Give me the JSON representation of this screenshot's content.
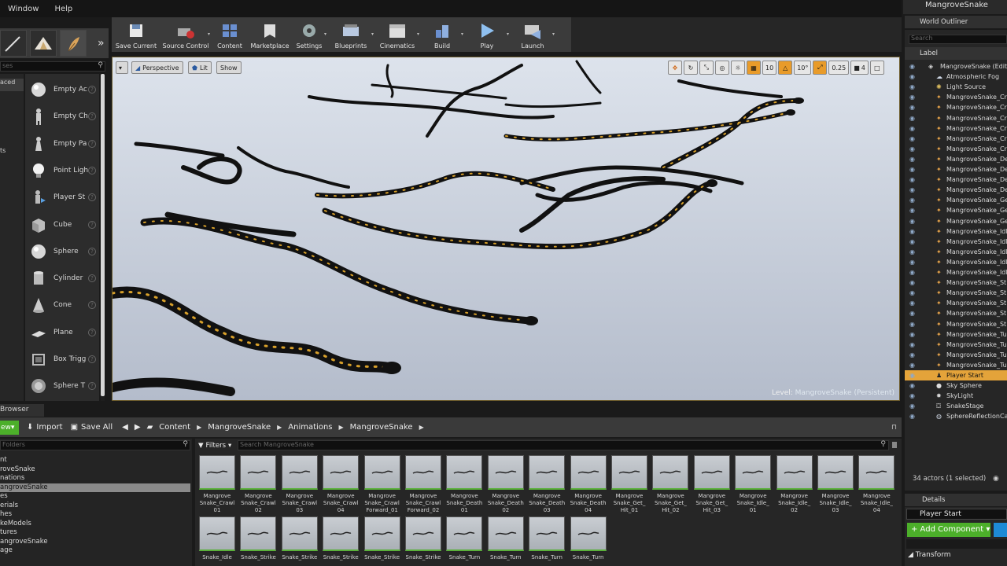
{
  "menu": {
    "items": [
      "Window",
      "Help"
    ]
  },
  "window": {
    "tab_title": "MangroveSnake"
  },
  "modes": {
    "search_placeholder": "ses",
    "categories": [
      "aced",
      "ts"
    ],
    "items": [
      {
        "label": "Empty Ac",
        "icon": "sphere-icon"
      },
      {
        "label": "Empty Ch",
        "icon": "mannequin-icon"
      },
      {
        "label": "Empty Pa",
        "icon": "pawn-icon"
      },
      {
        "label": "Point Ligh",
        "icon": "light-bulb-icon"
      },
      {
        "label": "Player St",
        "icon": "player-start-icon"
      },
      {
        "label": "Cube",
        "icon": "cube-icon"
      },
      {
        "label": "Sphere",
        "icon": "sphere-icon"
      },
      {
        "label": "Cylinder",
        "icon": "cylinder-icon"
      },
      {
        "label": "Cone",
        "icon": "cone-icon"
      },
      {
        "label": "Plane",
        "icon": "plane-icon"
      },
      {
        "label": "Box Trigg",
        "icon": "box-trigger-icon"
      },
      {
        "label": "Sphere T",
        "icon": "sphere-trigger-icon"
      }
    ]
  },
  "toolbar": {
    "buttons": [
      {
        "label": "Save Current",
        "icon": "save-icon",
        "dropdown": false
      },
      {
        "label": "Source Control",
        "icon": "source-control-icon",
        "dropdown": true
      },
      {
        "label": "Content",
        "icon": "content-icon",
        "dropdown": false
      },
      {
        "label": "Marketplace",
        "icon": "marketplace-icon",
        "dropdown": false
      },
      {
        "label": "Settings",
        "icon": "settings-icon",
        "dropdown": true
      },
      {
        "label": "Blueprints",
        "icon": "blueprints-icon",
        "dropdown": true
      },
      {
        "label": "Cinematics",
        "icon": "cinematics-icon",
        "dropdown": true
      },
      {
        "label": "Build",
        "icon": "build-icon",
        "dropdown": true
      },
      {
        "label": "Play",
        "icon": "play-icon",
        "dropdown": true
      },
      {
        "label": "Launch",
        "icon": "launch-icon",
        "dropdown": true
      }
    ]
  },
  "viewport": {
    "view_mode": "Perspective",
    "lighting": "Lit",
    "show": "Show",
    "grid_snap": "10",
    "rotation_snap": "10°",
    "scale_snap": "0.25",
    "camera_speed": "4",
    "level_label": "Level:",
    "level_name": "MangroveSnake (Persistent)"
  },
  "content_browser": {
    "tab": "Browser",
    "new_label": "ew",
    "import_label": "Import",
    "save_all_label": "Save All",
    "breadcrumbs": [
      "Content",
      "MangroveSnake",
      "Animations",
      "MangroveSnake"
    ],
    "folder_search_placeholder": "Folders",
    "tree": [
      "nt",
      "roveSnake",
      "nations",
      "angroveSnake",
      "es",
      "erials",
      "hes",
      "keModels",
      "tures",
      "angroveSnake",
      "age"
    ],
    "selected_tree_index": 3,
    "filters_label": "Filters",
    "asset_search_placeholder": "Search MangroveSnake",
    "assets": [
      "Mangrove\nSnake_Crawl\n01",
      "Mangrove\nSnake_Crawl\n02",
      "Mangrove\nSnake_Crawl\n03",
      "Mangrove\nSnake_Crawl\n04",
      "Mangrove\nSnake_Crawl\nForward_01",
      "Mangrove\nSnake_Crawl\nForward_02",
      "Mangrove\nSnake_Death\n01",
      "Mangrove\nSnake_Death\n02",
      "Mangrove\nSnake_Death\n03",
      "Mangrove\nSnake_Death\n04",
      "Mangrove\nSnake_Get_\nHit_01",
      "Mangrove\nSnake_Get_\nHit_02",
      "Mangrove\nSnake_Get_\nHit_03",
      "Mangrove\nSnake_Idle_\n01",
      "Mangrove\nSnake_Idle_\n02",
      "Mangrove\nSnake_Idle_\n03",
      "Mangrove\nSnake_Idle_\n04",
      "Snake_Idle",
      "Snake_Strike",
      "Snake_Strike",
      "Snake_Strike",
      "Snake_Strike",
      "Snake_Strike",
      "Snake_Turn",
      "Snake_Turn",
      "Snake_Turn",
      "Snake_Turn"
    ]
  },
  "outliner": {
    "tab": "World Outliner",
    "search_placeholder": "Search",
    "column_label": "Label",
    "rows": [
      {
        "text": "MangroveSnake (Edito",
        "indent": 0,
        "icon": "world-icon"
      },
      {
        "text": "Atmospheric Fog",
        "indent": 1,
        "icon": "fog-icon"
      },
      {
        "text": "Light Source",
        "indent": 1,
        "icon": "sun-icon"
      },
      {
        "text": "MangroveSnake_Cr",
        "indent": 1,
        "icon": "actor-icon"
      },
      {
        "text": "MangroveSnake_Cr",
        "indent": 1,
        "icon": "actor-icon"
      },
      {
        "text": "MangroveSnake_Cr",
        "indent": 1,
        "icon": "actor-icon"
      },
      {
        "text": "MangroveSnake_Cr",
        "indent": 1,
        "icon": "actor-icon"
      },
      {
        "text": "MangroveSnake_Cr",
        "indent": 1,
        "icon": "actor-icon"
      },
      {
        "text": "MangroveSnake_Cr",
        "indent": 1,
        "icon": "actor-icon"
      },
      {
        "text": "MangroveSnake_De",
        "indent": 1,
        "icon": "actor-icon"
      },
      {
        "text": "MangroveSnake_De",
        "indent": 1,
        "icon": "actor-icon"
      },
      {
        "text": "MangroveSnake_De",
        "indent": 1,
        "icon": "actor-icon"
      },
      {
        "text": "MangroveSnake_De",
        "indent": 1,
        "icon": "actor-icon"
      },
      {
        "text": "MangroveSnake_Ge",
        "indent": 1,
        "icon": "actor-icon"
      },
      {
        "text": "MangroveSnake_Ge",
        "indent": 1,
        "icon": "actor-icon"
      },
      {
        "text": "MangroveSnake_Ge",
        "indent": 1,
        "icon": "actor-icon"
      },
      {
        "text": "MangroveSnake_Idl",
        "indent": 1,
        "icon": "actor-icon"
      },
      {
        "text": "MangroveSnake_Idl",
        "indent": 1,
        "icon": "actor-icon"
      },
      {
        "text": "MangroveSnake_Idl",
        "indent": 1,
        "icon": "actor-icon"
      },
      {
        "text": "MangroveSnake_Idl",
        "indent": 1,
        "icon": "actor-icon"
      },
      {
        "text": "MangroveSnake_Idl",
        "indent": 1,
        "icon": "actor-icon"
      },
      {
        "text": "MangroveSnake_St",
        "indent": 1,
        "icon": "actor-icon"
      },
      {
        "text": "MangroveSnake_St",
        "indent": 1,
        "icon": "actor-icon"
      },
      {
        "text": "MangroveSnake_St",
        "indent": 1,
        "icon": "actor-icon"
      },
      {
        "text": "MangroveSnake_St",
        "indent": 1,
        "icon": "actor-icon"
      },
      {
        "text": "MangroveSnake_St",
        "indent": 1,
        "icon": "actor-icon"
      },
      {
        "text": "MangroveSnake_Tu",
        "indent": 1,
        "icon": "actor-icon"
      },
      {
        "text": "MangroveSnake_Tu",
        "indent": 1,
        "icon": "actor-icon"
      },
      {
        "text": "MangroveSnake_Tu",
        "indent": 1,
        "icon": "actor-icon"
      },
      {
        "text": "MangroveSnake_Tu",
        "indent": 1,
        "icon": "actor-icon"
      },
      {
        "text": "Player Start",
        "indent": 1,
        "icon": "player-start-icon",
        "selected": true
      },
      {
        "text": "Sky Sphere",
        "indent": 1,
        "icon": "sphere-icon"
      },
      {
        "text": "SkyLight",
        "indent": 1,
        "icon": "skylight-icon"
      },
      {
        "text": "SnakeStage",
        "indent": 1,
        "icon": "mesh-icon"
      },
      {
        "text": "SphereReflectionCa",
        "indent": 1,
        "icon": "reflection-icon"
      }
    ],
    "footer": "34 actors (1 selected)"
  },
  "details": {
    "tab": "Details",
    "name_value": "Player Start",
    "add_component_label": "+ Add Component ▾",
    "transform_label": "Transform"
  },
  "colors": {
    "accent_orange": "#e4a33a",
    "add_green": "#4caf2a",
    "selection_blue": "#1e8ad6"
  }
}
